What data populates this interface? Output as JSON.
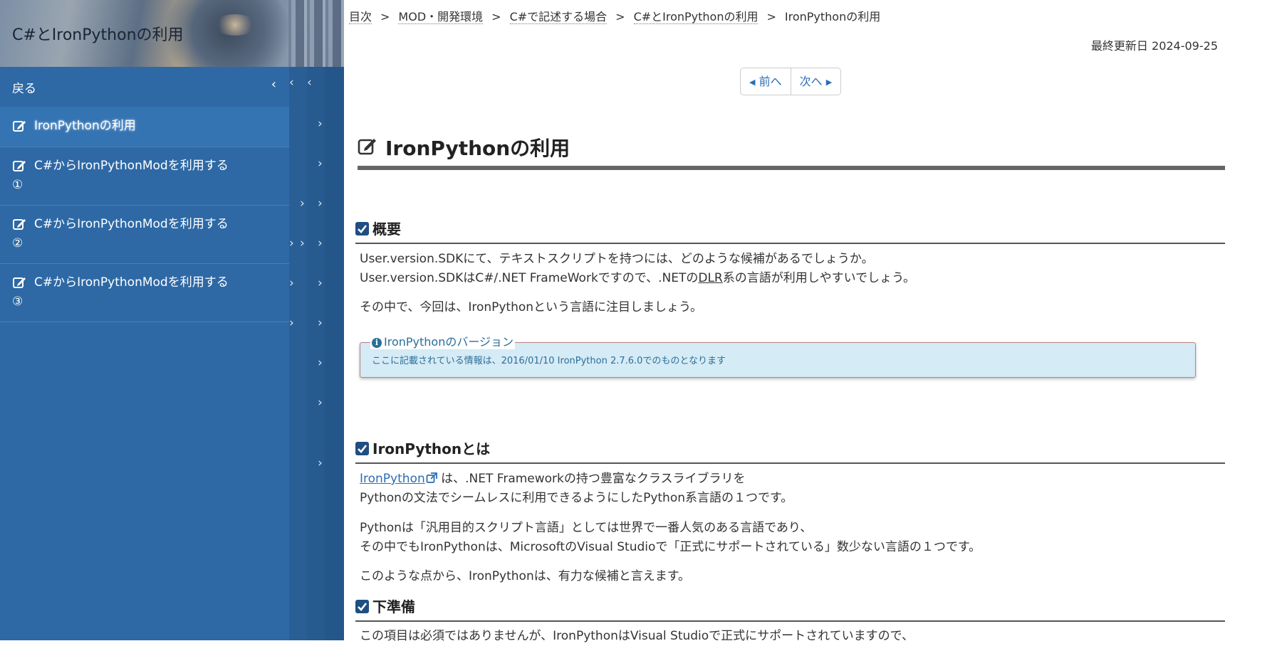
{
  "sidebar": {
    "site_title": "C#とIronPythonの利用",
    "back_label": "戻る",
    "items": [
      {
        "label": "IronPythonの利用",
        "active": true
      },
      {
        "label": "C#からIronPythonModを利用する①",
        "active": false
      },
      {
        "label": "C#からIronPythonModを利用する②",
        "active": false
      },
      {
        "label": "C#からIronPythonModを利用する③",
        "active": false
      }
    ]
  },
  "breadcrumb": {
    "items": [
      "目次",
      "MOD・開発環境",
      "C#で記述する場合",
      "C#とIronPythonの利用"
    ],
    "current": "IronPythonの利用",
    "separator": ">"
  },
  "last_updated": "最終更新日 2024-09-25",
  "pager": {
    "prev": "前へ",
    "next": "次へ"
  },
  "page_title": "IronPythonの利用",
  "sections": {
    "overview": {
      "heading": "概要",
      "p1_line1": "User.version.SDKにて、テキストスクリプトを持つには、どのような候補があるでしょうか。",
      "p1_line2_a": "User.version.SDKはC#/.NET FrameWorkですので、.NETの",
      "p1_line2_dlr": "DLR",
      "p1_line2_b": "系の言語が利用しやすいでしょう。",
      "p2": "その中で、今回は、IronPythonという言語に注目しましょう。",
      "info_title": "IronPythonのバージョン",
      "info_body": "ここに記載されている情報は、2016/01/10 IronPython 2.7.6.0でのものとなります"
    },
    "what_is": {
      "heading": "IronPythonとは",
      "link": "IronPython",
      "p1_line1_rest": " は、.NET Frameworkの持つ豊富なクラスライブラリを",
      "p1_line2": "Pythonの文法でシームレスに利用できるようにしたPython系言語の１つです。",
      "p2_line1": "Pythonは「汎用目的スクリプト言語」としては世界で一番人気のある言語であり、",
      "p2_line2": "その中でもIronPythonは、MicrosoftのVisual Studioで「正式にサポートされている」数少ない言語の１つです。",
      "p3": "このような点から、IronPythonは、有力な候補と言えます。"
    },
    "prep": {
      "heading": "下準備",
      "p1": "この項目は必須ではありませんが、IronPythonはVisual Studioで正式にサポートされていますので、"
    }
  },
  "icons": {
    "nav_item": "edit-icon",
    "section": "checkbox-checked-icon",
    "external": "external-link-icon",
    "info": "info-icon"
  },
  "colors": {
    "sidebar_bg": "#2e69a5",
    "accent_link": "#2a6db5",
    "section_checkbox": "#1f4e82",
    "info_bg": "#d5ebf5"
  }
}
